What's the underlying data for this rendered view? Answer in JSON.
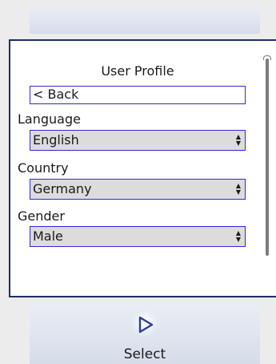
{
  "screen": {
    "title": "User Profile",
    "back_label": "< Back"
  },
  "fields": [
    {
      "label": "Language",
      "value": "English"
    },
    {
      "label": "Country",
      "value": "Germany"
    },
    {
      "label": "Gender",
      "value": "Male"
    }
  ],
  "softkey": {
    "label": "Select",
    "icon": "play-triangle-icon"
  },
  "colors": {
    "panel_border": "#1c2f66",
    "focus_border": "#2b2bd6",
    "select_bg": "#dcdcdc",
    "softkey_icon": "#2c3e94"
  }
}
